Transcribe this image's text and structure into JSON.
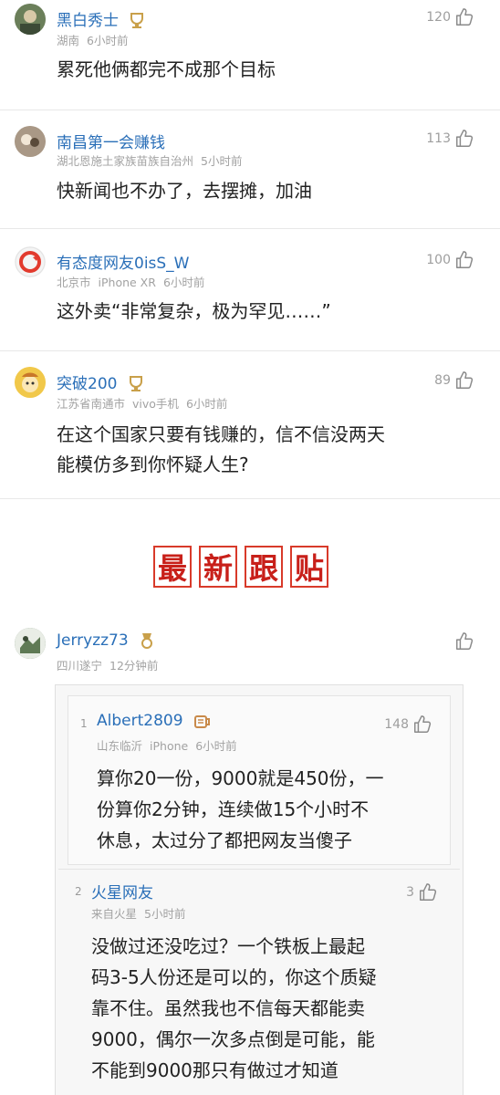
{
  "comments": [
    {
      "username": "黑白秀士",
      "location": "湖南",
      "time": "6小时前",
      "likes": "120",
      "text": "累死他俩都完不成那个目标"
    },
    {
      "username": "南昌第一会赚钱",
      "location": "湖北恩施土家族苗族自治州",
      "time": "5小时前",
      "likes": "113",
      "text": "快新闻也不办了，去摆摊，加油"
    },
    {
      "username": "有态度网友0isS_W",
      "location": "北京市",
      "device": "iPhone XR",
      "time": "6小时前",
      "likes": "100",
      "text": "这外卖“非常复杂，极为罕见……”"
    },
    {
      "username": "突破200",
      "location": "江苏省南通市",
      "device": "vivo手机",
      "time": "6小时前",
      "likes": "89",
      "text_line1": "在这个国家只要有钱赚的，信不信没两天",
      "text_line2": "能模仿多到你怀疑人生?"
    }
  ],
  "latest_banner": [
    "最",
    "新",
    "跟",
    "贴"
  ],
  "latest": {
    "username": "Jerryzz73",
    "location": "四川遂宁",
    "time": "12分钟前",
    "quotes": [
      {
        "floor": "1",
        "username": "Albert2809",
        "location": "山东临沂",
        "device": "iPhone",
        "time": "6小时前",
        "likes": "148",
        "line1": "算你20一份，9000就是450份，一",
        "line2": "份算你2分钟，连续做15个小时不",
        "line3": "休息，太过分了都把网友当傻子"
      },
      {
        "floor": "2",
        "username": "火星网友",
        "location": "来自火星",
        "time": "5小时前",
        "likes": "3",
        "line1": "没做过还没吃过？一个铁板上最起",
        "line2": "码3-5人份还是可以的，你这个质疑",
        "line3": "靠不住。虽然我也不信每天都能卖",
        "line4": "9000，偶尔一次多点倒是可能，能",
        "line5": "不能到9000那只有做过才知道"
      }
    ]
  },
  "colors": {
    "username": "#2a6fb8",
    "banner_red": "#c8201a",
    "badge_gold": "#c9a04a"
  }
}
